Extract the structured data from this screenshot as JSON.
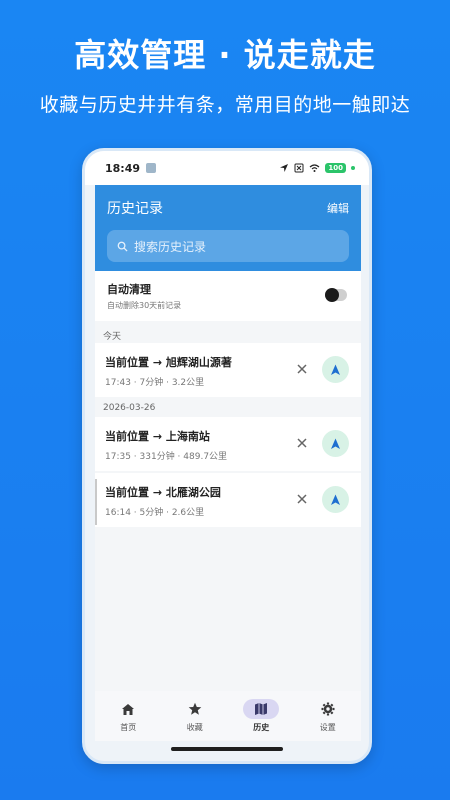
{
  "promo": {
    "title": "高效管理 · 说走就走",
    "subtitle": "收藏与历史井井有条，常用目的地一触即达"
  },
  "status_bar": {
    "time": "18:49",
    "battery": "100"
  },
  "header": {
    "title": "历史记录",
    "edit_label": "编辑"
  },
  "search": {
    "placeholder": "搜索历史记录"
  },
  "auto_clean": {
    "title": "自动清理",
    "description": "自动删除30天前记录",
    "enabled": false
  },
  "groups": [
    {
      "label": "今天",
      "items": [
        {
          "route": "当前位置 → 旭辉湖山源著",
          "meta": "17:43 · 7分钟 · 3.2公里"
        }
      ]
    },
    {
      "label": "2026-03-26",
      "items": [
        {
          "route": "当前位置 → 上海南站",
          "meta": "17:35 · 331分钟 · 489.7公里"
        },
        {
          "route": "当前位置 → 北雁湖公园",
          "meta": "16:14 · 5分钟 · 2.6公里"
        }
      ]
    }
  ],
  "tabs": [
    {
      "label": "首页",
      "icon": "home-icon",
      "active": false
    },
    {
      "label": "收藏",
      "icon": "star-icon",
      "active": false
    },
    {
      "label": "历史",
      "icon": "map-icon",
      "active": true
    },
    {
      "label": "设置",
      "icon": "gear-icon",
      "active": false
    }
  ],
  "colors": {
    "background": "#1a86f3",
    "header": "#2f8ddf",
    "nav_button": "#d8f2e6",
    "nav_arrow": "#1e6fd0",
    "active_tab": "#d9d7f2"
  }
}
